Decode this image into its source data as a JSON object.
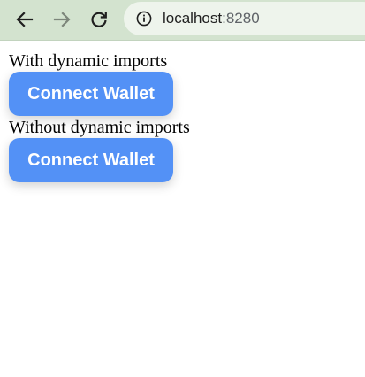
{
  "browser": {
    "url_host": "localhost",
    "url_port": ":8280",
    "toolbar_bg": "#d3e3cf",
    "icons": [
      "back-arrow-icon",
      "forward-arrow-icon",
      "reload-icon",
      "site-info-icon"
    ]
  },
  "page": {
    "sections": [
      {
        "label": "With dynamic imports",
        "button_label": "Connect Wallet"
      },
      {
        "label": "Without dynamic imports",
        "button_label": "Connect Wallet"
      }
    ],
    "button_color": "#5391f6"
  }
}
